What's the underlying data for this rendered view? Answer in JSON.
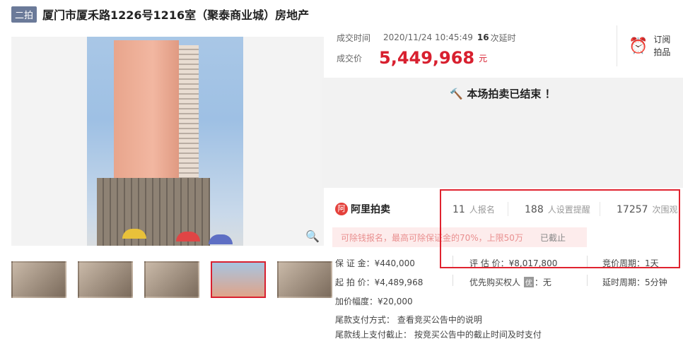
{
  "header": {
    "badge": "二拍",
    "title": "厦门市厦禾路1226号1216室（聚泰商业城）房地产"
  },
  "deal": {
    "time_label": "成交时间",
    "time_value": "2020/11/24 10:45:49",
    "delay_count": "16",
    "delay_label": "次延时",
    "price_label": "成交价",
    "price_value": "5,449,968",
    "price_unit": "元"
  },
  "subscribe": {
    "label_line1": "订阅",
    "label_line2": "拍品",
    "icon": "alarm-clock-icon"
  },
  "status": {
    "ended_text": "本场拍卖已结束 ！",
    "icon": "gavel-icon"
  },
  "platform": {
    "logo_mark": "阿",
    "name": "阿里拍卖"
  },
  "stats": [
    {
      "value": "11",
      "label": "人报名"
    },
    {
      "value": "188",
      "label": "人设置提醒"
    },
    {
      "value": "17257",
      "label": "次围观"
    }
  ],
  "deposit_notice": {
    "text": "可除钱报名，最高可除保证金的70%，上限50万",
    "status": "已截止"
  },
  "details": {
    "deposit": "保 证 金：¥440,000",
    "appraisal": "评 估 价：¥8,017,800",
    "cycle": "竞价周期：1天",
    "start_price": "起 拍 价：¥4,489,968",
    "priority_label": "优先购买权人",
    "priority_badge": "优",
    "priority_value": "：无",
    "delay_cycle": "延时周期：5分钟",
    "increment": "加价幅度：¥20,000"
  },
  "notes": {
    "payment_method": "尾款支付方式： 查看竞买公告中的说明",
    "payment_deadline": "尾款线上支付截止： 按竞买公告中的截止时间及时支付"
  },
  "thumbnails": [
    "thumb-1",
    "thumb-2",
    "thumb-3",
    "thumb-4",
    "thumb-5"
  ],
  "colors": {
    "accent": "#d8202f",
    "badge": "#6b7a99",
    "ended_bg": "#f2f2f2"
  }
}
